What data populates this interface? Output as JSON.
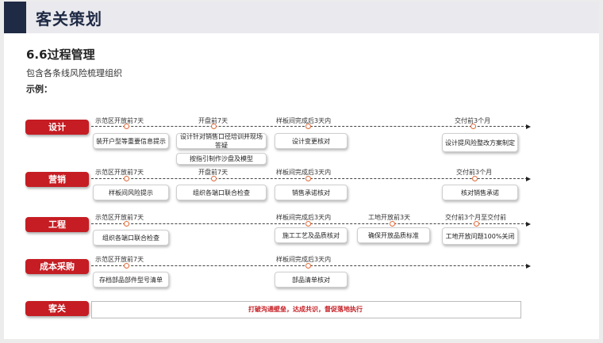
{
  "header": {
    "title": "客关策划"
  },
  "section": {
    "title": "6.6过程管理",
    "description": "包含各条线风险梳理组织",
    "example_label": "示例："
  },
  "rows": [
    {
      "label": "设计",
      "milestones": [
        "示范区开放前7天",
        "开盘前7天",
        "样板间完成后3天内",
        "交付前3个月"
      ],
      "tasks": [
        "装开户型等重要信息提示",
        "设计针对销售口径培训并现场答疑",
        "按指引制作沙盘及模型",
        "设计变更核对",
        "设计提风险整改方案制定"
      ]
    },
    {
      "label": "营销",
      "milestones": [
        "示范区开放前7天",
        "开盘前7天",
        "样板间完成后3天内",
        "交付前3个月"
      ],
      "tasks": [
        "样板间风险提示",
        "组织各端口联合检查",
        "销售承诺核对",
        "核对销售承诺"
      ]
    },
    {
      "label": "工程",
      "milestones": [
        "示范区开放前7天",
        "样板间完成后3天内",
        "工地开放前3天",
        "交付前3个月至交付前"
      ],
      "tasks": [
        "组织各端口联合检查",
        "施工工艺及品质核对",
        "确保开放品质标准",
        "工地开放问题100%关闭"
      ]
    },
    {
      "label": "成本采购",
      "milestones": [
        "示范区开放前7天",
        "样板间完成后3天内"
      ],
      "tasks": [
        "存档部品部件型号清单",
        "部品清单核对"
      ]
    }
  ],
  "customer": {
    "label": "客关",
    "text": "打破沟通壁垒，达成共识，督促落地执行"
  },
  "colors": {
    "accent": "#c51d23",
    "header_block": "#1f2a44",
    "milestone_dot": "#e26a3a"
  }
}
